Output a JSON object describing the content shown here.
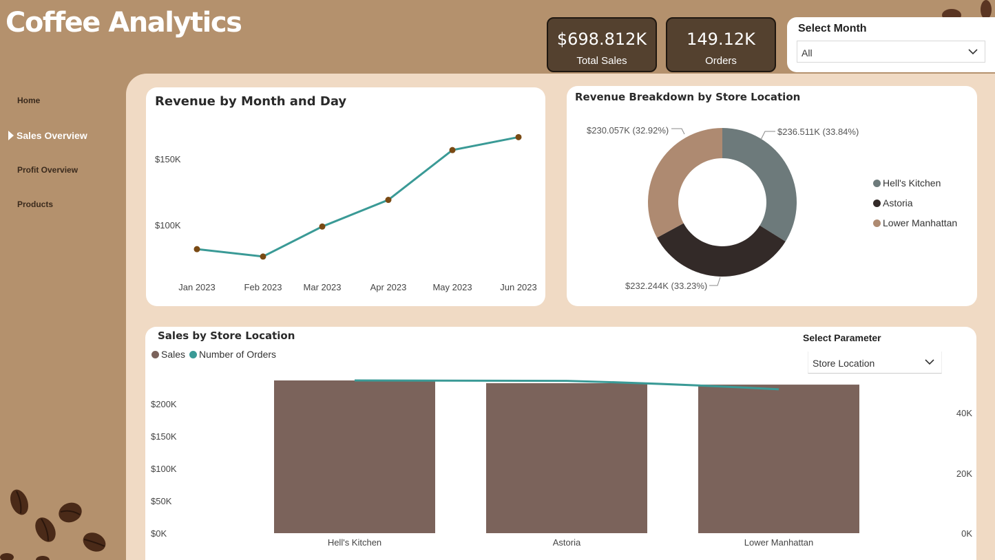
{
  "header": {
    "app_title": "Coffee Analytics",
    "kpis": [
      {
        "value": "$698.812K",
        "label": "Total Sales"
      },
      {
        "value": "149.12K",
        "label": "Orders"
      }
    ],
    "month_slicer": {
      "title": "Select Month",
      "selected": "All"
    }
  },
  "nav": {
    "items": [
      {
        "label": "Home",
        "active": false
      },
      {
        "label": "Sales Overview",
        "active": true
      },
      {
        "label": "Profit Overview",
        "active": false
      },
      {
        "label": "Products",
        "active": false
      }
    ]
  },
  "colors": {
    "background": "#b4916d",
    "panel": "#f0dac4",
    "kpi_fill": "#54412f",
    "line": "#3a9a96",
    "marker": "#7a4a14",
    "bar": "#7b635b",
    "hells_kitchen": "#6d7a7b",
    "astoria": "#332a28",
    "lower_manhattan": "#ae8a71"
  },
  "revenue_chart": {
    "title": "Revenue by Month and Day",
    "y_ticks": [
      "$150K",
      "$100K"
    ]
  },
  "breakdown_chart": {
    "title": "Revenue Breakdown by Store Location",
    "slice_labels": [
      "$236.511K (33.84%)",
      "$232.244K (33.23%)",
      "$230.057K (32.92%)"
    ],
    "legend": [
      "Hell's Kitchen",
      "Astoria",
      "Lower Manhattan"
    ]
  },
  "sales_chart": {
    "title": "Sales by Store Location",
    "legend": [
      "Sales",
      "Number of Orders"
    ],
    "param_slicer": {
      "title": "Select Parameter",
      "selected": "Store Location"
    },
    "y_left_ticks": [
      "$0K",
      "$50K",
      "$100K",
      "$150K",
      "$200K"
    ],
    "y_right_ticks": [
      "0K",
      "20K",
      "40K"
    ]
  },
  "chart_data": [
    {
      "type": "line",
      "title": "Revenue by Month and Day",
      "x": [
        "Jan 2023",
        "Feb 2023",
        "Mar 2023",
        "Apr 2023",
        "May 2023",
        "Jun 2023"
      ],
      "series": [
        {
          "values": [
            81700,
            76100,
            98800,
            119000,
            156700,
            166500
          ]
        }
      ],
      "ylim": [
        48000,
        190000
      ],
      "y_ticks": [
        100000,
        150000
      ]
    },
    {
      "type": "pie",
      "title": "Revenue Breakdown by Store Location",
      "donut": true,
      "labels": [
        "Hell's Kitchen",
        "Astoria",
        "Lower Manhattan"
      ],
      "values": [
        236.511,
        232.244,
        230.057
      ],
      "percentages": [
        33.84,
        33.23,
        32.92
      ],
      "legend_position": "right"
    },
    {
      "type": "bar",
      "title": "Sales by Store Location",
      "categories": [
        "Hell's Kitchen",
        "Astoria",
        "Lower Manhattan"
      ],
      "series": [
        {
          "name": "Sales",
          "values": [
            236511,
            232244,
            230057
          ]
        },
        {
          "name": "Number of Orders",
          "values": [
            50735,
            50599,
            47782
          ],
          "axis": "right",
          "type": "line"
        }
      ],
      "ylim": [
        0,
        236511
      ],
      "y2lim": [
        0,
        50735
      ],
      "legend_position": "top-left"
    }
  ]
}
